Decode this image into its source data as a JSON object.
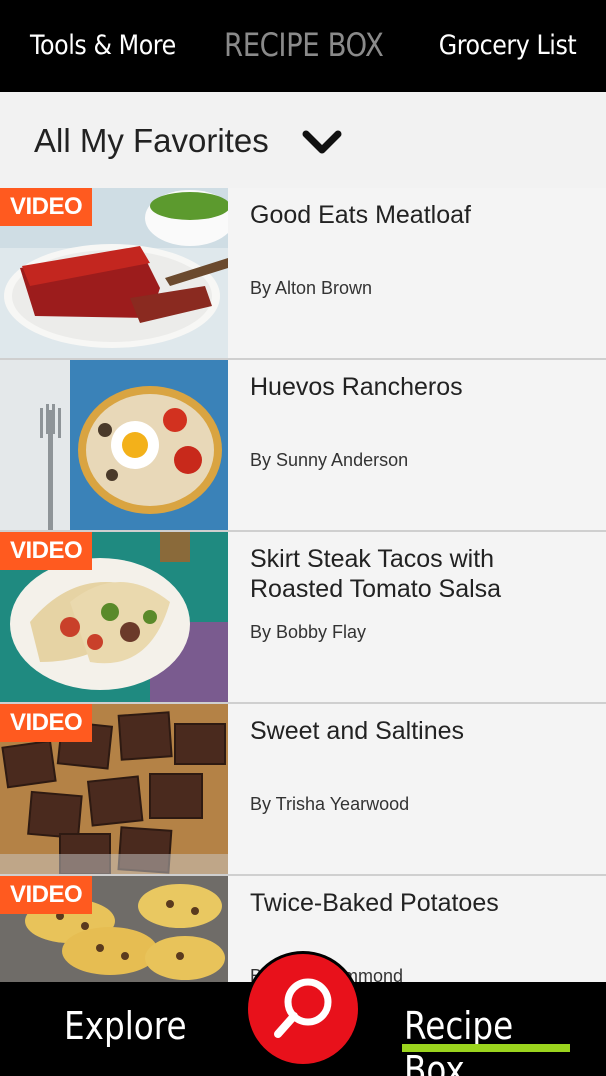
{
  "top_nav": {
    "left": "Tools & More",
    "center": "RECIPE BOX",
    "right": "Grocery List"
  },
  "filter": {
    "label": "All My Favorites"
  },
  "recipes": [
    {
      "video": "VIDEO",
      "title": "Good Eats Meatloaf",
      "author": "By Alton Brown"
    },
    {
      "video": "",
      "title": "Huevos Rancheros",
      "author": "By Sunny Anderson"
    },
    {
      "video": "VIDEO",
      "title": "Skirt Steak Tacos with Roasted Tomato Salsa",
      "author": "By Bobby Flay"
    },
    {
      "video": "VIDEO",
      "title": "Sweet and Saltines",
      "author": "By Trisha Yearwood"
    },
    {
      "video": "VIDEO",
      "title": "Twice-Baked Potatoes",
      "author": "By Ree Drummond"
    }
  ],
  "bottom_nav": {
    "explore": "Explore",
    "recipe_box": "Recipe Box"
  },
  "colors": {
    "video_badge": "#ff5a1f",
    "search_button": "#e8111b",
    "active_underline": "#9bd41e"
  },
  "icons": {
    "filter_toggle": "chevron-down-icon",
    "search": "search-icon"
  }
}
